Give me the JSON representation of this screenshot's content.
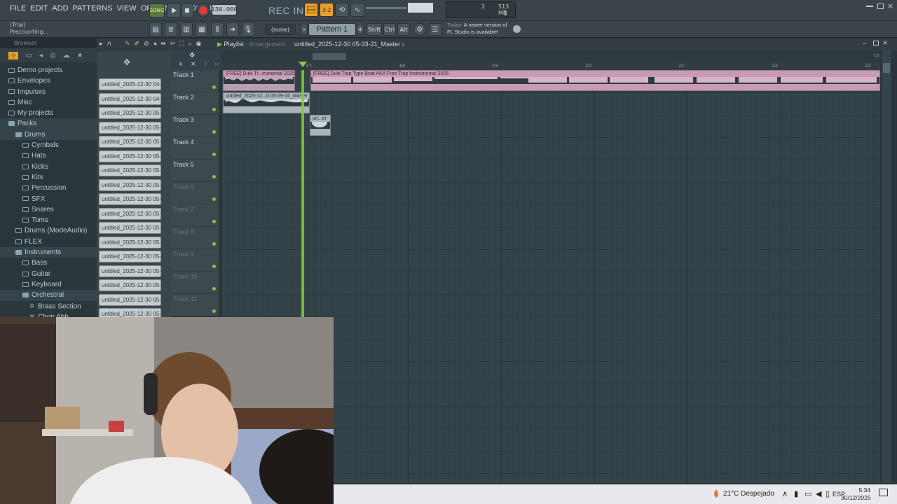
{
  "menu": [
    "FILE",
    "EDIT",
    "ADD",
    "PATTERNS",
    "VIEW",
    "OPTIONS",
    "TOOLS",
    "HELP"
  ],
  "transport": {
    "mode": "SONG",
    "tempo": "130.000",
    "rec_in": "REC IN 1"
  },
  "monitor": {
    "value1": "2",
    "memory": "513 MB",
    "value2": "1"
  },
  "hint": {
    "line1": "(Trial)",
    "line2": "Precounting..."
  },
  "toolbar2": {
    "pattern_select": "(none)",
    "pattern": "Pattern 1",
    "shift": "Shift",
    "ctrl": "Ctrl",
    "alt": "Alt"
  },
  "news": {
    "label": "Today:",
    "line1": "A newer version of",
    "line2": "FL Studio is available!"
  },
  "browser": {
    "title": "Browser",
    "items": [
      {
        "label": "Demo projects",
        "level": 0,
        "open": false
      },
      {
        "label": "Envelopes",
        "level": 0,
        "open": false
      },
      {
        "label": "Impulses",
        "level": 0,
        "open": false
      },
      {
        "label": "Misc",
        "level": 0,
        "open": false
      },
      {
        "label": "My projects",
        "level": 0,
        "open": false
      },
      {
        "label": "Packs",
        "level": 0,
        "open": true
      },
      {
        "label": "Drums",
        "level": 1,
        "open": true
      },
      {
        "label": "Cymbals",
        "level": 2,
        "open": false
      },
      {
        "label": "Hats",
        "level": 2,
        "open": false
      },
      {
        "label": "Kicks",
        "level": 2,
        "open": false
      },
      {
        "label": "Kits",
        "level": 2,
        "open": false
      },
      {
        "label": "Percussion",
        "level": 2,
        "open": false
      },
      {
        "label": "SFX",
        "level": 2,
        "open": false
      },
      {
        "label": "Snares",
        "level": 2,
        "open": false
      },
      {
        "label": "Toms",
        "level": 2,
        "open": false
      },
      {
        "label": "Drums (ModeAudio)",
        "level": 1,
        "open": false
      },
      {
        "label": "FLEX",
        "level": 1,
        "open": false
      },
      {
        "label": "Instruments",
        "level": 1,
        "open": true
      },
      {
        "label": "Bass",
        "level": 2,
        "open": false
      },
      {
        "label": "Guitar",
        "level": 2,
        "open": false
      },
      {
        "label": "Keyboard",
        "level": 2,
        "open": false
      },
      {
        "label": "Orchestral",
        "level": 2,
        "open": true
      },
      {
        "label": "Brass Section",
        "level": 3,
        "open": false
      },
      {
        "label": "Choir Ahh",
        "level": 3,
        "open": false
      }
    ]
  },
  "channels": [
    "untitled_2025-12-30 04-...",
    "untitled_2025-12-30 04-...",
    "untitled_2025-12-30 05-...",
    "untitled_2025-12-30 05-...",
    "untitled_2025-12-30 05-...",
    "untitled_2025-12-30 05-...",
    "untitled_2025-12-30 05-...",
    "untitled_2025-12-30 05-...",
    "untitled_2025-12-30 05-...",
    "untitled_2025-12-30 05-...",
    "untitled_2025-12-30 05-...",
    "untitled_2025-12-30 05-...",
    "untitled_2025-12-30 05-...",
    "untitled_2025-12-30 05-...",
    "untitled_2025-12-30 05-...",
    "untitled_2025-12-30 05-...",
    "untitled_2025-12-30 05-..."
  ],
  "playlist": {
    "title": "Playlist",
    "subtitle": "Arrangement",
    "project": "untitled_2025-12-30 05-33-21_Master",
    "ruler": [
      "17",
      "18",
      "19",
      "20",
      "21",
      "22",
      "23"
    ],
    "tracks": [
      {
        "name": "Track 1",
        "active": true
      },
      {
        "name": "Track 2",
        "active": true
      },
      {
        "name": "Track 3",
        "active": true
      },
      {
        "name": "Track 4",
        "active": true
      },
      {
        "name": "Track 5",
        "active": true
      },
      {
        "name": "Track 6",
        "active": false
      },
      {
        "name": "Track 7",
        "active": false
      },
      {
        "name": "Track 8",
        "active": false
      },
      {
        "name": "Track 9",
        "active": false
      },
      {
        "name": "Track 10",
        "active": false
      },
      {
        "name": "Track 11",
        "active": false
      }
    ],
    "clips": [
      {
        "label": "[FREE] Duki Tr...trumental 2025",
        "track": 1
      },
      {
        "label": "[FREE] Duki Trap Type Beat AKA  Free Trap Instrumental 2025",
        "track": 1
      },
      {
        "label": "untitled_2025-12...0 05-29-16_Master",
        "track": 2
      },
      {
        "label": "un...er",
        "track": 3
      }
    ]
  },
  "taskbar": {
    "weather": "21°C  Despejado",
    "lang": "ESP",
    "time": "5:34",
    "date": "30/12/2025"
  },
  "colors": {
    "accent_green": "#8bc34a",
    "playhead": "#7ed321",
    "clip_pink": "#c79bb3",
    "clip_gray": "#aab4b8"
  }
}
